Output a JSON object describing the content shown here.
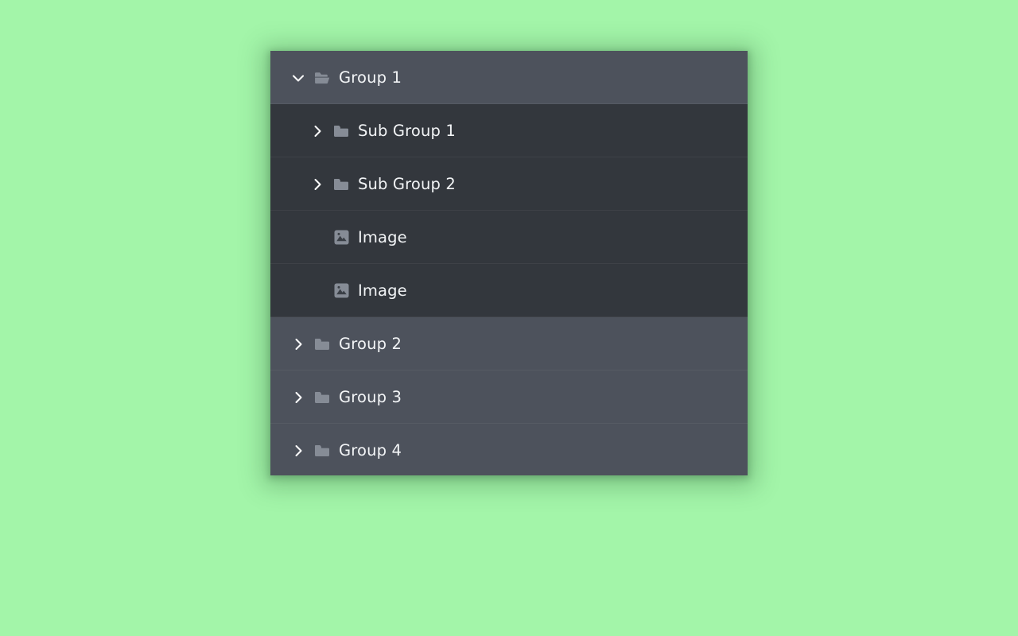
{
  "theme": {
    "page_background": "#a3f5a9",
    "panel_background": "#4d525c",
    "row_background_top_level": "#4d525c",
    "row_background_nested": "#33373d",
    "row_divider": "rgba(255,255,255,0.055)",
    "label_color": "#f2f4f6",
    "chevron_color": "#ffffff",
    "folder_icon_color": "#868c96",
    "image_icon_tile_color": "#868c96",
    "image_icon_glyph_color": "#3a3f46"
  },
  "tree": {
    "rows": [
      {
        "label": "Group 1",
        "depth": 0,
        "kind": "folder",
        "expanded": true,
        "chevron": "chevron-down",
        "icon": "folder-open-icon",
        "has_chevron": true
      },
      {
        "label": "Sub Group 1",
        "depth": 1,
        "kind": "folder",
        "expanded": false,
        "chevron": "chevron-right",
        "icon": "folder-closed-icon",
        "has_chevron": true
      },
      {
        "label": "Sub Group 2",
        "depth": 1,
        "kind": "folder",
        "expanded": false,
        "chevron": "chevron-right",
        "icon": "folder-closed-icon",
        "has_chevron": true
      },
      {
        "label": "Image",
        "depth": 2,
        "kind": "image",
        "expanded": false,
        "chevron": "",
        "icon": "image-icon",
        "has_chevron": false
      },
      {
        "label": "Image",
        "depth": 2,
        "kind": "image",
        "expanded": false,
        "chevron": "",
        "icon": "image-icon",
        "has_chevron": false
      },
      {
        "label": "Group 2",
        "depth": 0,
        "kind": "folder",
        "expanded": false,
        "chevron": "chevron-right",
        "icon": "folder-closed-icon",
        "has_chevron": true
      },
      {
        "label": "Group 3",
        "depth": 0,
        "kind": "folder",
        "expanded": false,
        "chevron": "chevron-right",
        "icon": "folder-closed-icon",
        "has_chevron": true
      },
      {
        "label": "Group 4",
        "depth": 0,
        "kind": "folder",
        "expanded": false,
        "chevron": "chevron-right",
        "icon": "folder-closed-icon",
        "has_chevron": true
      }
    ]
  }
}
